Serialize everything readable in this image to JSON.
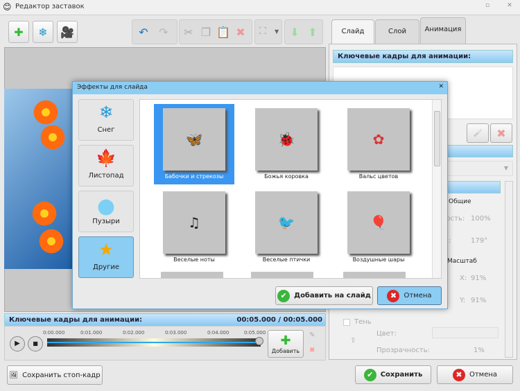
{
  "window": {
    "title": "Редактор заставок"
  },
  "toolbar": {
    "icons": [
      "add-icon",
      "snowflake-icon",
      "camera-icon",
      "undo-icon",
      "redo-icon",
      "cut-icon",
      "copy-icon",
      "paste-icon",
      "delete-icon",
      "fit-icon",
      "move-down-icon",
      "move-up-icon"
    ]
  },
  "right_panel": {
    "tabs": [
      "Слайд",
      "Слой",
      "Анимация"
    ],
    "active_tab": "Анимация",
    "keyframes_header": "Ключевые кадры для анимации:",
    "general_tab": "Общие",
    "opacity_label": "ность:",
    "opacity_value": "100%",
    "angle_label": ":",
    "angle_value": "179°",
    "scale_tab": "Масштаб",
    "x_label": "X:",
    "x_value": "91%",
    "y_label": "Y:",
    "y_value": "91%",
    "shadow_label": "Тень",
    "color_label": "Цвет:",
    "transparency_label": "Прозрачность:",
    "transparency_value": "1%"
  },
  "timeline": {
    "header": "Ключевые кадры для анимации:",
    "time": "00:05.000 / 00:05.000",
    "ticks": [
      "0:00.000",
      "0:01.000",
      "0:02.000",
      "0:03.000",
      "0:04.000",
      "0:05.000"
    ],
    "add_label": "Добавить",
    "position": 1.0
  },
  "bottom": {
    "save_frame": "Сохранить стоп-кадр",
    "save": "Сохранить",
    "cancel": "Отмена"
  },
  "dialog": {
    "title": "Эффекты для слайда",
    "categories": [
      {
        "label": "Снег",
        "icon": "❄"
      },
      {
        "label": "Листопад",
        "icon": "🍁"
      },
      {
        "label": "Пузыри",
        "icon": "●"
      },
      {
        "label": "Другие",
        "icon": "★"
      }
    ],
    "selected_category": "Другие",
    "effects": [
      {
        "label": "Бабочки и стрекозы",
        "icon": "🦋"
      },
      {
        "label": "Божья коровка",
        "icon": "🐞"
      },
      {
        "label": "Вальс цветов",
        "icon": "✿"
      },
      {
        "label": "Веселые ноты",
        "icon": "♫"
      },
      {
        "label": "Веселые птички",
        "icon": "🐦"
      },
      {
        "label": "Воздушные шары",
        "icon": "🎈"
      }
    ],
    "selected_effect": "Бабочки и стрекозы",
    "add_button": "Добавить на слайд",
    "cancel_button": "Отмена"
  },
  "colors": {
    "accent": "#8ccdf3",
    "selection": "#3a96f0"
  }
}
